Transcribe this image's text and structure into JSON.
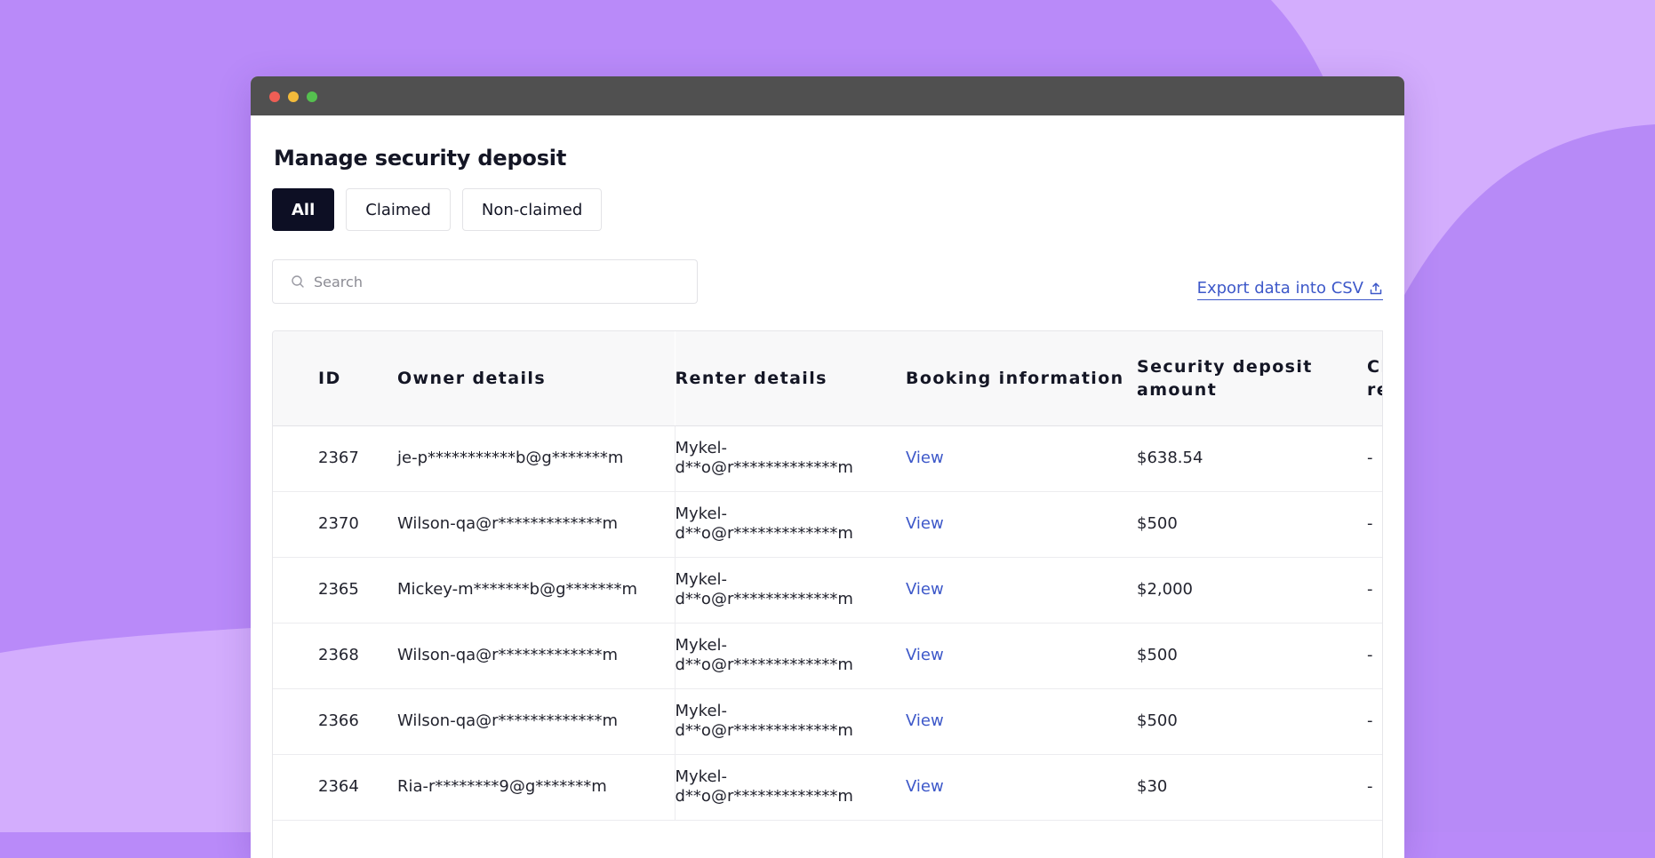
{
  "colors": {
    "background": "#b98af9",
    "accent_link": "#3d58c9",
    "active_filter": "#0d0f24",
    "titlebar": "#505050"
  },
  "page": {
    "title": "Manage security deposit"
  },
  "filters": [
    {
      "label": "All",
      "active": true
    },
    {
      "label": "Claimed",
      "active": false
    },
    {
      "label": "Non-claimed",
      "active": false
    }
  ],
  "search": {
    "placeholder": "Search",
    "value": "",
    "icon": "search-icon"
  },
  "export": {
    "label": "Export data into CSV",
    "icon": "upload-icon"
  },
  "table": {
    "headers": {
      "id": "ID",
      "owner": "Owner details",
      "renter": "Renter details",
      "booking": "Booking information",
      "deposit": "Security deposit amount",
      "claim": "Claim request"
    },
    "rows": [
      {
        "id": "2367",
        "owner": "je-p***********b@g*******m",
        "renter_line1": "Mykel-",
        "renter_line2": "d**o@r*************m",
        "booking": "View",
        "deposit": "$638.54",
        "claim": "-"
      },
      {
        "id": "2370",
        "owner": "Wilson-qa@r*************m",
        "renter_line1": "Mykel-",
        "renter_line2": "d**o@r*************m",
        "booking": "View",
        "deposit": "$500",
        "claim": "-"
      },
      {
        "id": "2365",
        "owner": "Mickey-m*******b@g*******m",
        "renter_line1": "Mykel-",
        "renter_line2": "d**o@r*************m",
        "booking": "View",
        "deposit": "$2,000",
        "claim": "-"
      },
      {
        "id": "2368",
        "owner": "Wilson-qa@r*************m",
        "renter_line1": "Mykel-",
        "renter_line2": "d**o@r*************m",
        "booking": "View",
        "deposit": "$500",
        "claim": "-"
      },
      {
        "id": "2366",
        "owner": "Wilson-qa@r*************m",
        "renter_line1": "Mykel-",
        "renter_line2": "d**o@r*************m",
        "booking": "View",
        "deposit": "$500",
        "claim": "-"
      },
      {
        "id": "2364",
        "owner": "Ria-r********9@g*******m",
        "renter_line1": "Mykel-",
        "renter_line2": "d**o@r*************m",
        "booking": "View",
        "deposit": "$30",
        "claim": "-"
      }
    ]
  }
}
